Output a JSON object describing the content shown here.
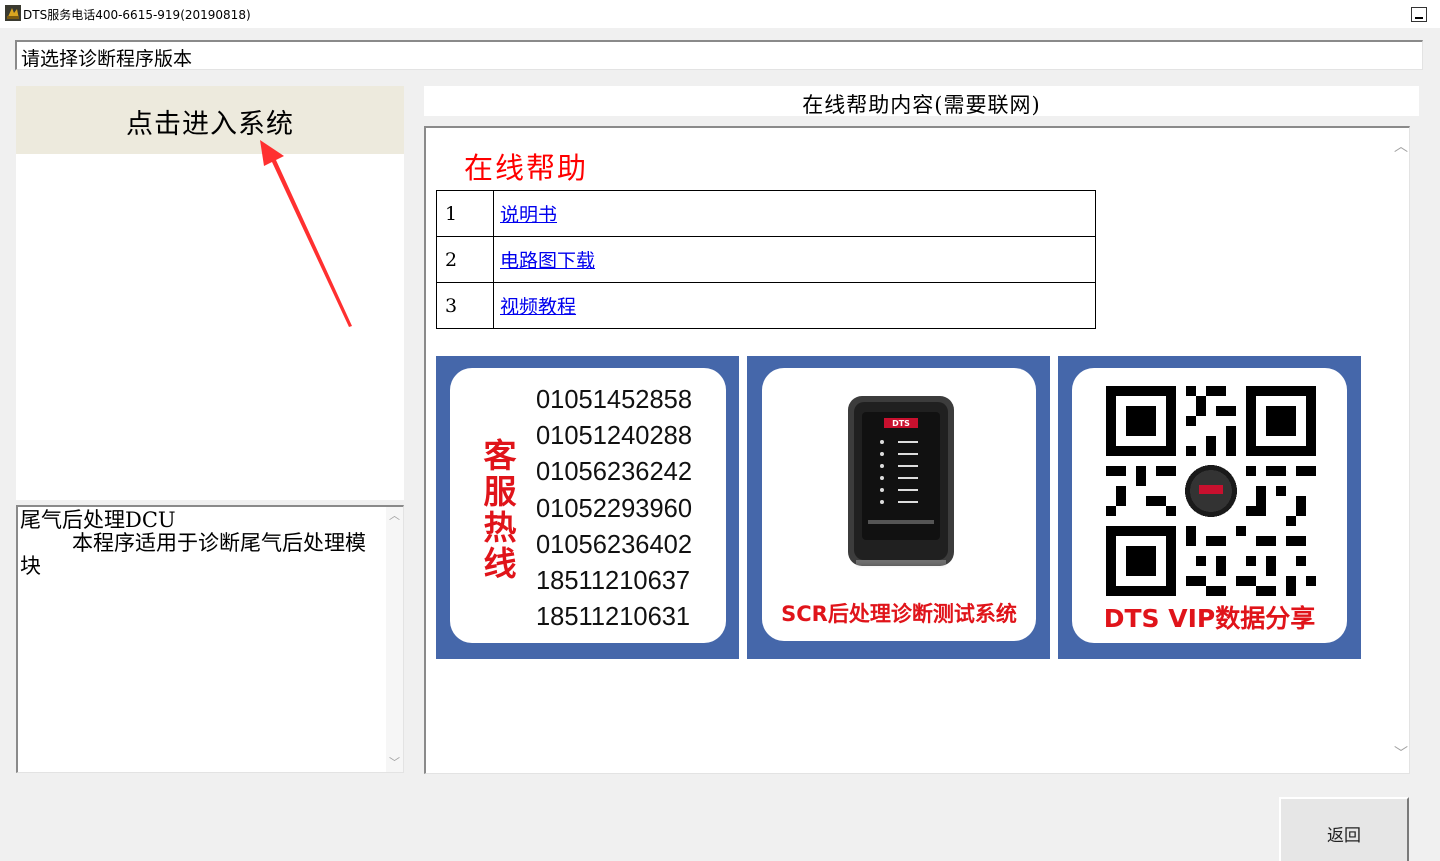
{
  "window": {
    "title": "DTS服务电话400-6615-919(20190818)",
    "icon": "dts-app-icon",
    "minimize_icon": "minimize-icon"
  },
  "version_selector": {
    "prompt": "请选择诊断程序版本"
  },
  "left_panel": {
    "enter_button_label": "点击进入系统",
    "annotation_color": "#ff3030",
    "description": {
      "line1": "尾气后处理DCU",
      "line2": "本程序适用于诊断尾气后处理模块"
    }
  },
  "help": {
    "header": "在线帮助内容(需要联网)",
    "title": "在线帮助",
    "title_color": "#ff0000",
    "links": [
      {
        "num": "1",
        "label": "说明书"
      },
      {
        "num": "2",
        "label": "电路图下载"
      },
      {
        "num": "3",
        "label": "视频教程"
      }
    ],
    "link_color": "#0000ee"
  },
  "cards": {
    "border_color": "#4567aa",
    "hotline": {
      "label": "客服热线",
      "phones": [
        "01051452858",
        "01051240288",
        "01056236242",
        "01052293960",
        "01056236402",
        "18511210637",
        "18511210631"
      ]
    },
    "product": {
      "caption": "SCR后处理诊断测试系统",
      "device_brand": "DTS"
    },
    "vip": {
      "caption": "DTS VIP数据分享",
      "qr_icon": "qr-code-icon"
    },
    "accent_red": "#e0141a"
  },
  "footer": {
    "back_label": "返回"
  }
}
